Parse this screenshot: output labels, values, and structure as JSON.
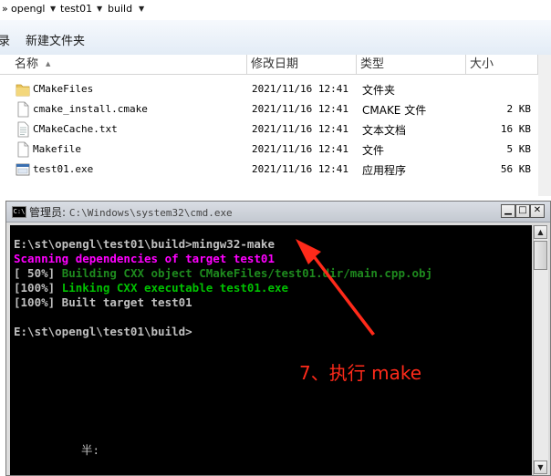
{
  "breadcrumb": {
    "items": [
      "opengl",
      "test01",
      "build"
    ],
    "lead": "»"
  },
  "toolbar": {
    "items": [
      "录",
      "新建文件夹"
    ]
  },
  "columns": {
    "name": "名称",
    "date": "修改日期",
    "type": "类型",
    "size": "大小"
  },
  "files": [
    {
      "icon": "folder-icon",
      "name": "CMakeFiles",
      "date": "2021/11/16 12:41",
      "type": "文件夹",
      "size": ""
    },
    {
      "icon": "file-icon",
      "name": "cmake_install.cmake",
      "date": "2021/11/16 12:41",
      "type": "CMAKE 文件",
      "size": "2 KB"
    },
    {
      "icon": "text-file-icon",
      "name": "CMakeCache.txt",
      "date": "2021/11/16 12:41",
      "type": "文本文档",
      "size": "16 KB"
    },
    {
      "icon": "file-icon",
      "name": "Makefile",
      "date": "2021/11/16 12:41",
      "type": "文件",
      "size": "5 KB"
    },
    {
      "icon": "exe-icon",
      "name": "test01.exe",
      "date": "2021/11/16 12:41",
      "type": "应用程序",
      "size": "56 KB"
    }
  ],
  "console": {
    "title_role": "管理员:",
    "title_path": "C:\\Windows\\system32\\cmd.exe",
    "lines": [
      {
        "text": "E:\\st\\opengl\\test01\\build>mingw32-make",
        "color": "white"
      },
      {
        "text": "Scanning dependencies of target test01",
        "color": "magenta"
      },
      {
        "text": "[ 50%] Building CXX object CMakeFiles/test01.dir/main.cpp.obj",
        "color": "dkgreen",
        "prefix": "[ 50%] ",
        "rest": "Building CXX object CMakeFiles/test01.dir/main.cpp.obj"
      },
      {
        "text": "[100%] Linking CXX executable test01.exe",
        "color": "green",
        "prefix": "[100%] ",
        "rest": "Linking CXX executable test01.exe"
      },
      {
        "text": "[100%] Built target test01",
        "color": "white"
      },
      {
        "text": "",
        "color": "white"
      },
      {
        "text": "E:\\st\\opengl\\test01\\build>",
        "color": "white"
      }
    ],
    "ime_text": "半:"
  },
  "annotation": {
    "text": "7、执行 make",
    "color": "#ff2a1a"
  },
  "colors": {
    "console_bg": "#000000",
    "magenta": "#ff00ff",
    "green": "#00c000",
    "dark_green": "#1e8a1e"
  }
}
